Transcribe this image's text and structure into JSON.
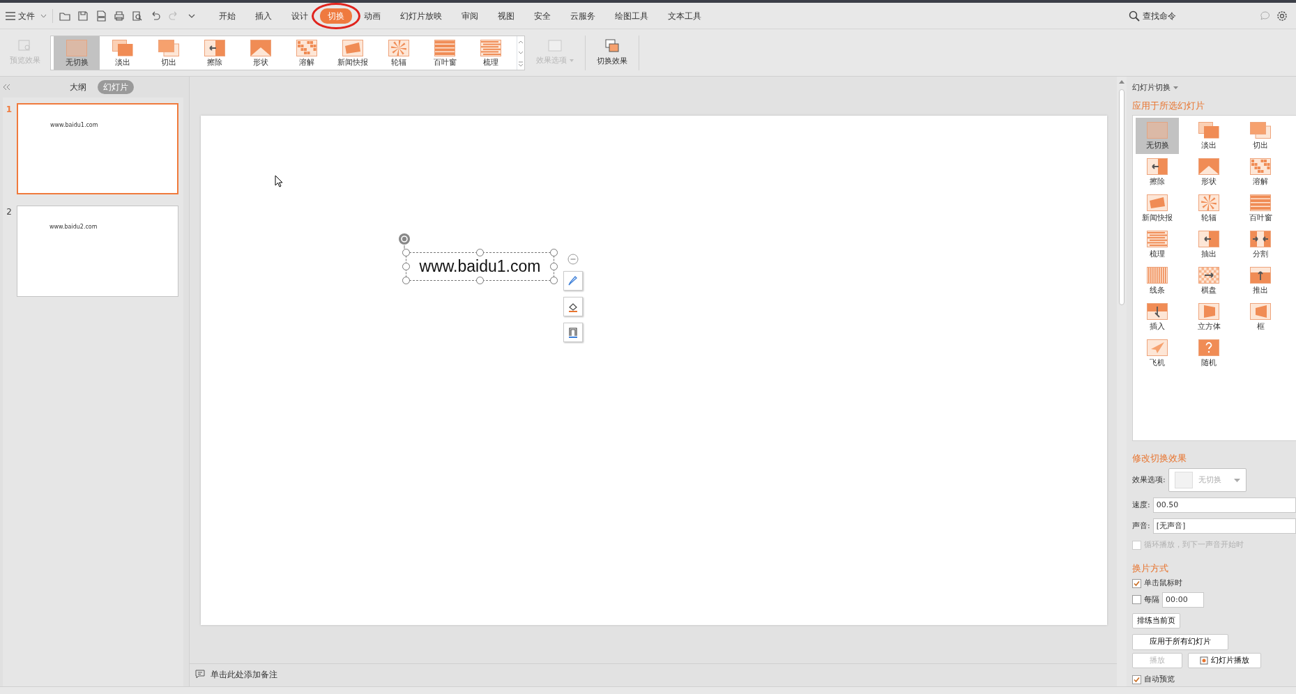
{
  "menu": {
    "file_label": "文件",
    "tabs": [
      {
        "label": "开始",
        "selected": false,
        "circled": false
      },
      {
        "label": "插入",
        "selected": false,
        "circled": false
      },
      {
        "label": "设计",
        "selected": false,
        "circled": false
      },
      {
        "label": "切换",
        "selected": true,
        "circled": true
      },
      {
        "label": "动画",
        "selected": false,
        "circled": false
      },
      {
        "label": "幻灯片放映",
        "selected": false,
        "circled": false
      },
      {
        "label": "审阅",
        "selected": false,
        "circled": false
      },
      {
        "label": "视图",
        "selected": false,
        "circled": false
      },
      {
        "label": "安全",
        "selected": false,
        "circled": false
      },
      {
        "label": "云服务",
        "selected": false,
        "circled": false
      },
      {
        "label": "绘图工具",
        "selected": false,
        "circled": false
      },
      {
        "label": "文本工具",
        "selected": false,
        "circled": false
      }
    ],
    "search_command": "查找命令"
  },
  "ribbon": {
    "preview": {
      "label": "预览效果",
      "disabled": true
    },
    "transitions": [
      {
        "label": "无切换",
        "selected": true
      },
      {
        "label": "淡出",
        "selected": false
      },
      {
        "label": "切出",
        "selected": false
      },
      {
        "label": "擦除",
        "selected": false
      },
      {
        "label": "形状",
        "selected": false
      },
      {
        "label": "溶解",
        "selected": false
      },
      {
        "label": "新闻快报",
        "selected": false
      },
      {
        "label": "轮辐",
        "selected": false
      },
      {
        "label": "百叶窗",
        "selected": false
      },
      {
        "label": "梳理",
        "selected": false
      }
    ],
    "effect_options": {
      "label": "效果选项",
      "disabled": true
    },
    "transition_effect": {
      "label": "切换效果"
    }
  },
  "slide_panel": {
    "tabs": [
      {
        "label": "大纲",
        "selected": false
      },
      {
        "label": "幻灯片",
        "selected": true
      }
    ],
    "slides": [
      {
        "number": "1",
        "text": "www.baidu1.com",
        "selected": true
      },
      {
        "number": "2",
        "text": "www.baidu2.com",
        "selected": false
      }
    ]
  },
  "slide": {
    "textbox": "www.baidu1.com"
  },
  "notes_placeholder": "单击此处添加备注",
  "transition_pane": {
    "title": "幻灯片切换",
    "apply_heading": "应用于所选幻灯片",
    "transitions": [
      {
        "label": "无切换",
        "selected": true
      },
      {
        "label": "淡出",
        "selected": false
      },
      {
        "label": "切出",
        "selected": false
      },
      {
        "label": "擦除",
        "selected": false
      },
      {
        "label": "形状",
        "selected": false
      },
      {
        "label": "溶解",
        "selected": false
      },
      {
        "label": "新闻快报",
        "selected": false
      },
      {
        "label": "轮辐",
        "selected": false
      },
      {
        "label": "百叶窗",
        "selected": false
      },
      {
        "label": "梳理",
        "selected": false
      },
      {
        "label": "抽出",
        "selected": false
      },
      {
        "label": "分割",
        "selected": false
      },
      {
        "label": "线条",
        "selected": false
      },
      {
        "label": "棋盘",
        "selected": false
      },
      {
        "label": "推出",
        "selected": false
      },
      {
        "label": "插入",
        "selected": false
      },
      {
        "label": "立方体",
        "selected": false
      },
      {
        "label": "框",
        "selected": false
      },
      {
        "label": "飞机",
        "selected": false
      },
      {
        "label": "随机",
        "selected": false
      }
    ],
    "modify_heading": "修改切换效果",
    "effect_options": {
      "label": "效果选项:",
      "value": "无切换",
      "disabled": true
    },
    "speed": {
      "label": "速度:",
      "value": "00.50"
    },
    "sound": {
      "label": "声音:",
      "value": "[无声音]"
    },
    "loop": {
      "label": "循环播放，到下一声音开始时",
      "checked": false,
      "disabled": true
    },
    "advance_heading": "换片方式",
    "on_click": {
      "label": "单击鼠标时",
      "checked": true
    },
    "every": {
      "label": "每隔",
      "checked": false,
      "value": "00:00"
    },
    "rehearse": "排练当前页",
    "apply_all": "应用于所有幻灯片",
    "play": {
      "label": "播放",
      "disabled": true
    },
    "slideshow": "幻灯片播放",
    "auto_preview": {
      "label": "自动预览",
      "checked": true
    }
  }
}
